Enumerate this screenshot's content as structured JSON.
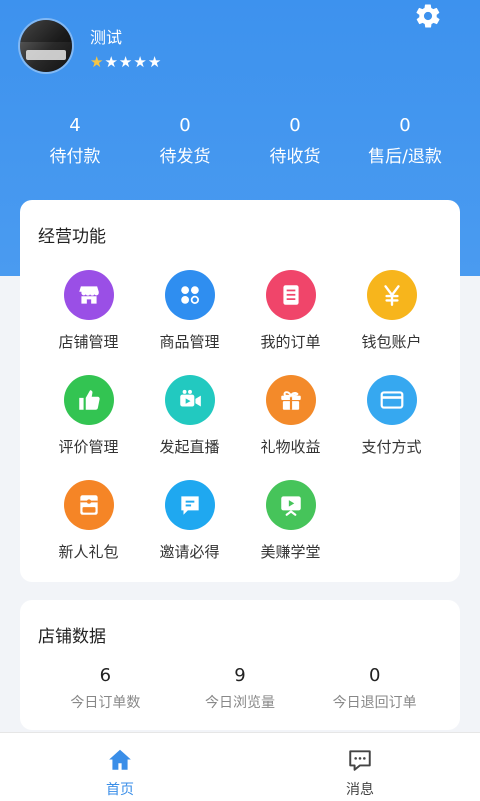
{
  "colors": {
    "header_bg": "#4a9bf0",
    "accent": "#3a8ee8",
    "star_filled": "#f6c443"
  },
  "profile": {
    "username": "测试",
    "rating": 1,
    "rating_max": 5,
    "settings_icon": "gear-icon"
  },
  "order_stats": [
    {
      "count": "4",
      "label": "待付款"
    },
    {
      "count": "0",
      "label": "待发货"
    },
    {
      "count": "0",
      "label": "待收货"
    },
    {
      "count": "0",
      "label": "售后/退款"
    }
  ],
  "functions": {
    "title": "经营功能",
    "items": [
      {
        "label": "店铺管理",
        "icon": "store-icon",
        "color": "#9a4fe6"
      },
      {
        "label": "商品管理",
        "icon": "goods-icon",
        "color": "#2f8ef0"
      },
      {
        "label": "我的订单",
        "icon": "order-icon",
        "color": "#f0456a"
      },
      {
        "label": "钱包账户",
        "icon": "wallet-yen-icon",
        "color": "#f7b51c"
      },
      {
        "label": "评价管理",
        "icon": "thumbs-up-icon",
        "color": "#33c452"
      },
      {
        "label": "发起直播",
        "icon": "video-camera-icon",
        "color": "#22c9c0"
      },
      {
        "label": "礼物收益",
        "icon": "gift-icon",
        "color": "#f38a2a"
      },
      {
        "label": "支付方式",
        "icon": "card-icon",
        "color": "#36a8f0"
      },
      {
        "label": "新人礼包",
        "icon": "new-gift-icon",
        "color": "#f58526"
      },
      {
        "label": "邀请必得",
        "icon": "invite-icon",
        "color": "#1fa8f0"
      },
      {
        "label": "美赚学堂",
        "icon": "play-classroom-icon",
        "color": "#46c45a"
      }
    ]
  },
  "shop_data": {
    "title": "店铺数据",
    "stats": [
      {
        "value": "6",
        "label": "今日订单数"
      },
      {
        "value": "9",
        "label": "今日浏览量"
      },
      {
        "value": "0",
        "label": "今日退回订单"
      }
    ]
  },
  "tabbar": [
    {
      "label": "首页",
      "icon": "home-icon",
      "active": true
    },
    {
      "label": "消息",
      "icon": "message-icon",
      "active": false
    }
  ]
}
